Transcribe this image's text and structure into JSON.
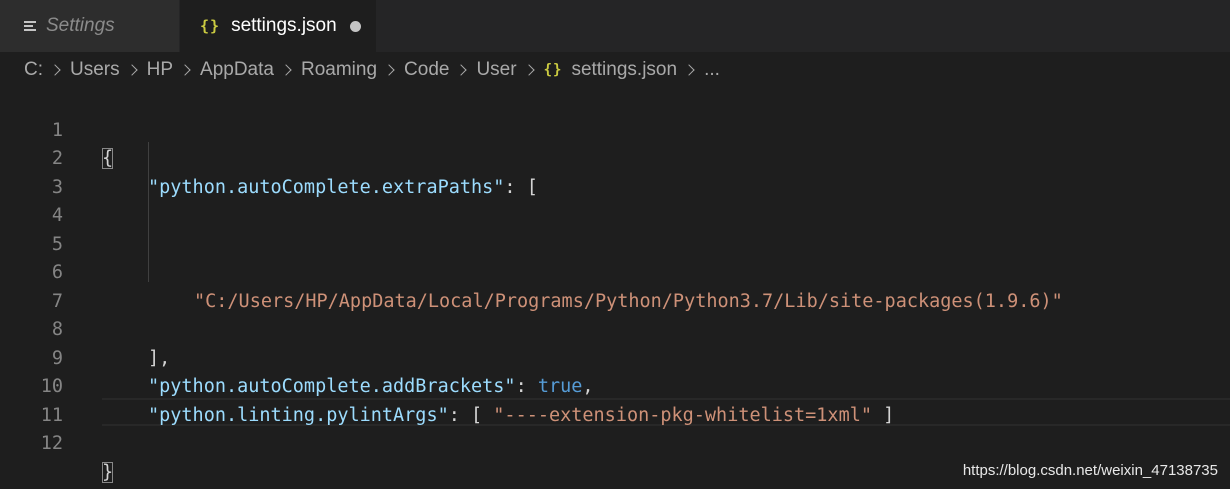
{
  "tabs": [
    {
      "label": "Settings",
      "icon": "list-icon",
      "active": false,
      "italic": true
    },
    {
      "label": "settings.json",
      "icon": "json-braces-icon",
      "active": true,
      "dirty": true
    }
  ],
  "breadcrumb": {
    "items": [
      "C:",
      "Users",
      "HP",
      "AppData",
      "Roaming",
      "Code",
      "User"
    ],
    "file_icon": "{}",
    "file": "settings.json",
    "more": "..."
  },
  "icons": {
    "braces": "{}",
    "separator": "chevron-right-icon"
  },
  "editor": {
    "line_numbers": [
      "1",
      "2",
      "3",
      "4",
      "5",
      "6",
      "7",
      "8",
      "9",
      "10",
      "11",
      "12"
    ],
    "lines": {
      "open_brace": "{",
      "key_extra_paths": "\"python.autoComplete.extraPaths\"",
      "colon_open_bracket": ": [",
      "path_value": "\"C:/Users/HP/AppData/Local/Programs/Python/Python3.7/Lib/site-packages(1.9.6)\"",
      "close_bracket": "],",
      "key_add_brackets": "\"python.autoComplete.addBrackets\"",
      "colon": ": ",
      "true_value": "true",
      "comma": ",",
      "key_pylint_args": "\"python.linting.pylintArgs\"",
      "colon_bracket_space": ": [ ",
      "pylint_value": "\"----extension-pkg-whitelist=1xml\"",
      "space_close_bracket": " ]",
      "close_brace": "}"
    }
  },
  "colors": {
    "background": "#1e1e1e",
    "key": "#9cdcfe",
    "string": "#ce9178",
    "boolean": "#569cd6",
    "json_icon": "#cbcb41"
  },
  "watermark": "https://blog.csdn.net/weixin_47138735"
}
